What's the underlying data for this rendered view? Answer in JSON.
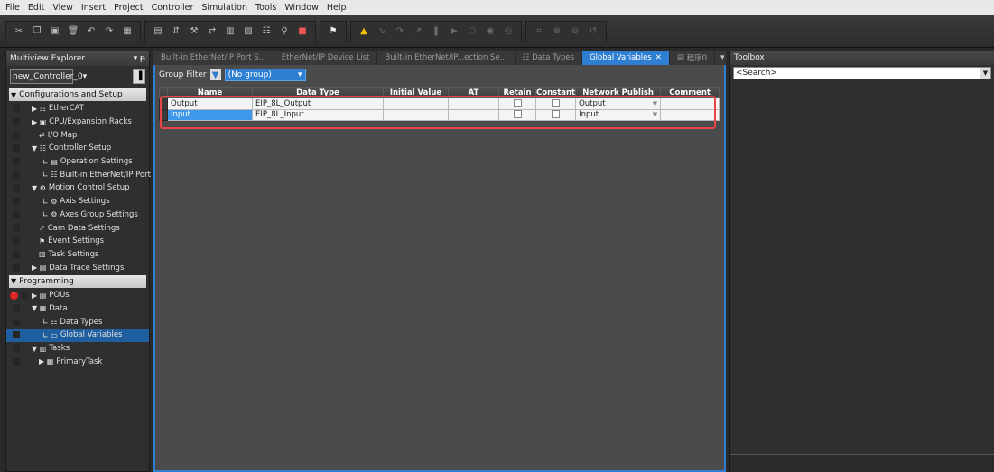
{
  "menu": [
    "File",
    "Edit",
    "View",
    "Insert",
    "Project",
    "Controller",
    "Simulation",
    "Tools",
    "Window",
    "Help"
  ],
  "explorer": {
    "title": "Multiview Explorer",
    "pin": "▾ ᵽ",
    "controller": "new_Controller_0",
    "sections": {
      "config": "Configurations and Setup",
      "programming": "Programming"
    },
    "config_items": [
      {
        "label": "EtherCAT",
        "icon": "▶ ☷"
      },
      {
        "label": "CPU/Expansion Racks",
        "icon": "▶ ▣"
      },
      {
        "label": "I/O Map",
        "icon": "⇄"
      },
      {
        "label": "Controller Setup",
        "icon": "▼ ☷"
      },
      {
        "label": "Operation Settings",
        "icon": "∟ ▤"
      },
      {
        "label": "Built-in EtherNet/IP Port",
        "icon": "∟ ☷"
      },
      {
        "label": "Motion Control Setup",
        "icon": "▼ ⚙"
      },
      {
        "label": "Axis Settings",
        "icon": "∟ ⚙"
      },
      {
        "label": "Axes Group Settings",
        "icon": "∟ ⚙"
      },
      {
        "label": "Cam Data Settings",
        "icon": "↗"
      },
      {
        "label": "Event Settings",
        "icon": "⚑"
      },
      {
        "label": "Task Settings",
        "icon": "▥"
      },
      {
        "label": "Data Trace Settings",
        "icon": "▶ ▤"
      }
    ],
    "prog_items": [
      {
        "label": "POUs",
        "icon": "▶ ▤"
      },
      {
        "label": "Data",
        "icon": "▼ ▦"
      },
      {
        "label": "Data Types",
        "icon": "∟ ☷"
      },
      {
        "label": "Global Variables",
        "icon": "∟ ▭"
      },
      {
        "label": "Tasks",
        "icon": "▼ ▥"
      },
      {
        "label": "PrimaryTask",
        "icon": "▶ ▦"
      }
    ]
  },
  "tabs": [
    {
      "label": "Built-in EtherNet/IP Port S..."
    },
    {
      "label": "EtherNet/IP Device List"
    },
    {
      "label": "Built-in EtherNet/IP...ection Se..."
    },
    {
      "label": "Data Types"
    },
    {
      "label": "Global Variables"
    },
    {
      "label": "程序0"
    }
  ],
  "editor": {
    "group_filter_label": "Group Filter",
    "group_filter_value": "(No group)",
    "columns": [
      "Name",
      "Data Type",
      "Initial Value",
      "AT",
      "Retain",
      "Constant",
      "Network Publish",
      "Comment"
    ],
    "rows": [
      {
        "name": "Output",
        "data_type": "EIP_8L_Output",
        "initial": "",
        "at": "",
        "network_publish": "Output",
        "comment": ""
      },
      {
        "name": "Input",
        "data_type": "EIP_8L_Input",
        "initial": "",
        "at": "",
        "network_publish": "Input",
        "comment": ""
      }
    ]
  },
  "toolbox": {
    "title": "Toolbox",
    "search_placeholder": "<Search>"
  },
  "colors": {
    "accent": "#2e7fd1",
    "highlight_box": "#e84646",
    "selection": "#3d98ea"
  }
}
